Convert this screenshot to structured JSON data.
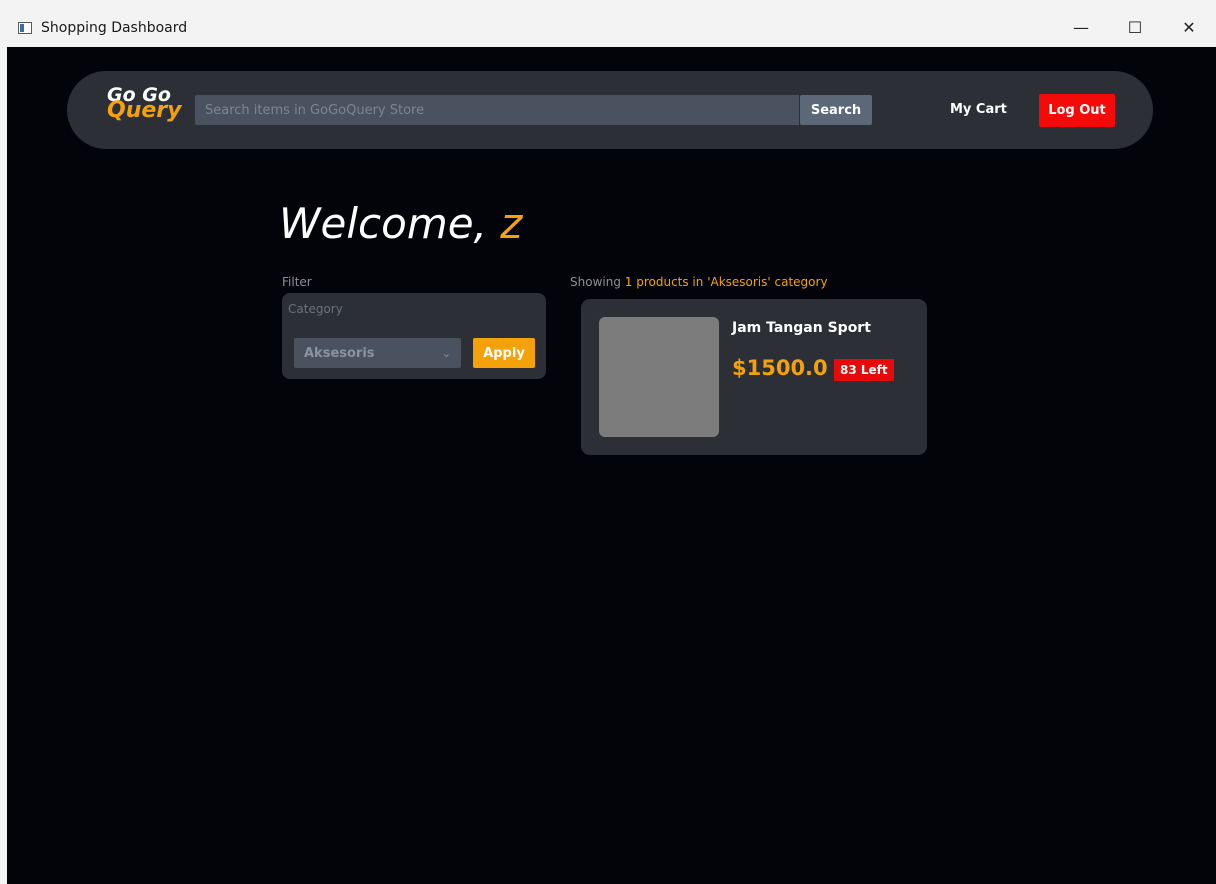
{
  "window": {
    "title": "Shopping Dashboard",
    "controls": {
      "minimize": "—",
      "maximize": "☐",
      "close": "✕"
    }
  },
  "navbar": {
    "logo_line1": "Go Go",
    "logo_line2": "Query",
    "search_placeholder": "Search items in GoGoQuery Store",
    "search_value": "",
    "search_label": "Search",
    "cart_label": "My Cart",
    "logout_label": "Log Out"
  },
  "welcome": {
    "greeting": "Welcome,",
    "username": "z"
  },
  "filter": {
    "label": "Filter",
    "category_label": "Category",
    "selected_category": "Aksesoris",
    "apply_label": "Apply"
  },
  "results": {
    "prefix": "Showing",
    "summary": "1 products in 'Aksesoris' category"
  },
  "products": [
    {
      "name": "Jam Tangan Sport",
      "price": "$1500.0",
      "stock": "83 Left"
    }
  ],
  "colors": {
    "background": "#03030a",
    "panel": "#2c2f36",
    "accent": "#f5a20a",
    "danger": "#f50a0a"
  }
}
